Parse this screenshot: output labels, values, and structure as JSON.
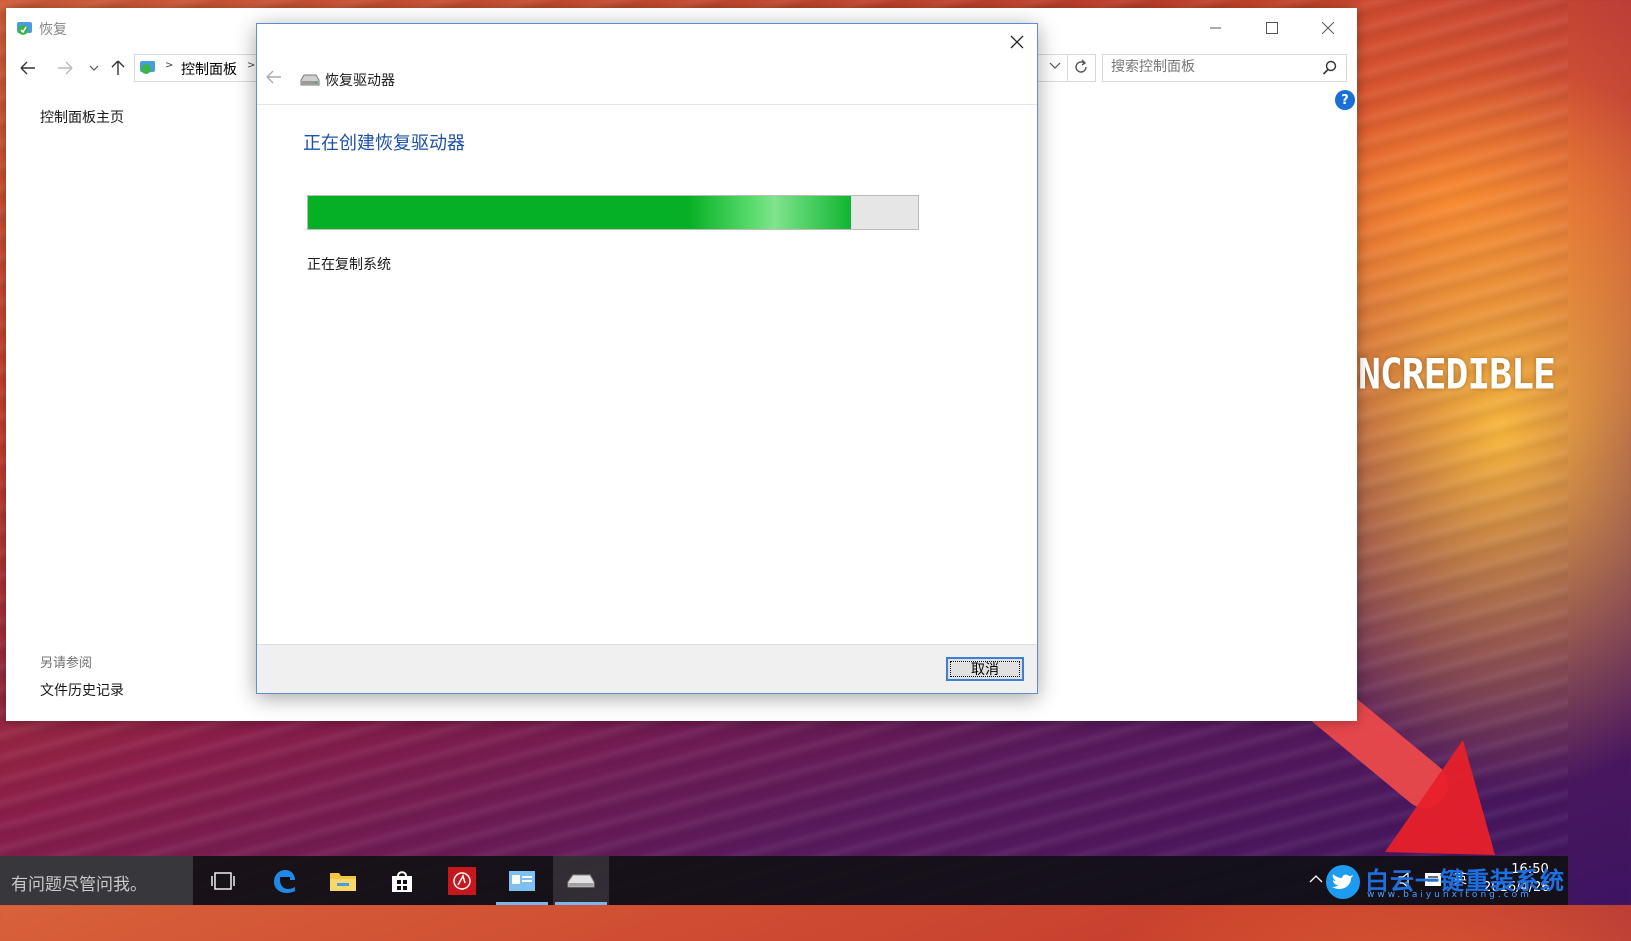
{
  "wallpaper": {
    "slogan": "NCREDIBLE"
  },
  "control_panel": {
    "title": "恢复",
    "breadcrumb": [
      "控制面板"
    ],
    "search_placeholder": "搜索控制面板",
    "sidebar": {
      "home_link": "控制面板主页",
      "see_also_heading": "另请参阅",
      "see_also_links": [
        "文件历史记录"
      ]
    }
  },
  "dialog": {
    "title": "恢复驱动器",
    "heading": "正在创建恢复驱动器",
    "progress_fraction": 0.89,
    "status": "正在复制系统",
    "cancel_label": "取消",
    "colors": {
      "heading": "#1f50a8",
      "progress": "#06b025"
    }
  },
  "taskbar": {
    "search_placeholder": "有问题尽管问我。",
    "apps": [
      "task-view",
      "edge",
      "file-explorer",
      "store",
      "app-red",
      "control-panel",
      "recovery-drive"
    ],
    "tray": {
      "ime": "英",
      "time": "16:50",
      "date": "2016/4/26"
    }
  },
  "watermark": {
    "text": "白云一键重装系统",
    "url": "www.baiyunxitong.com"
  }
}
